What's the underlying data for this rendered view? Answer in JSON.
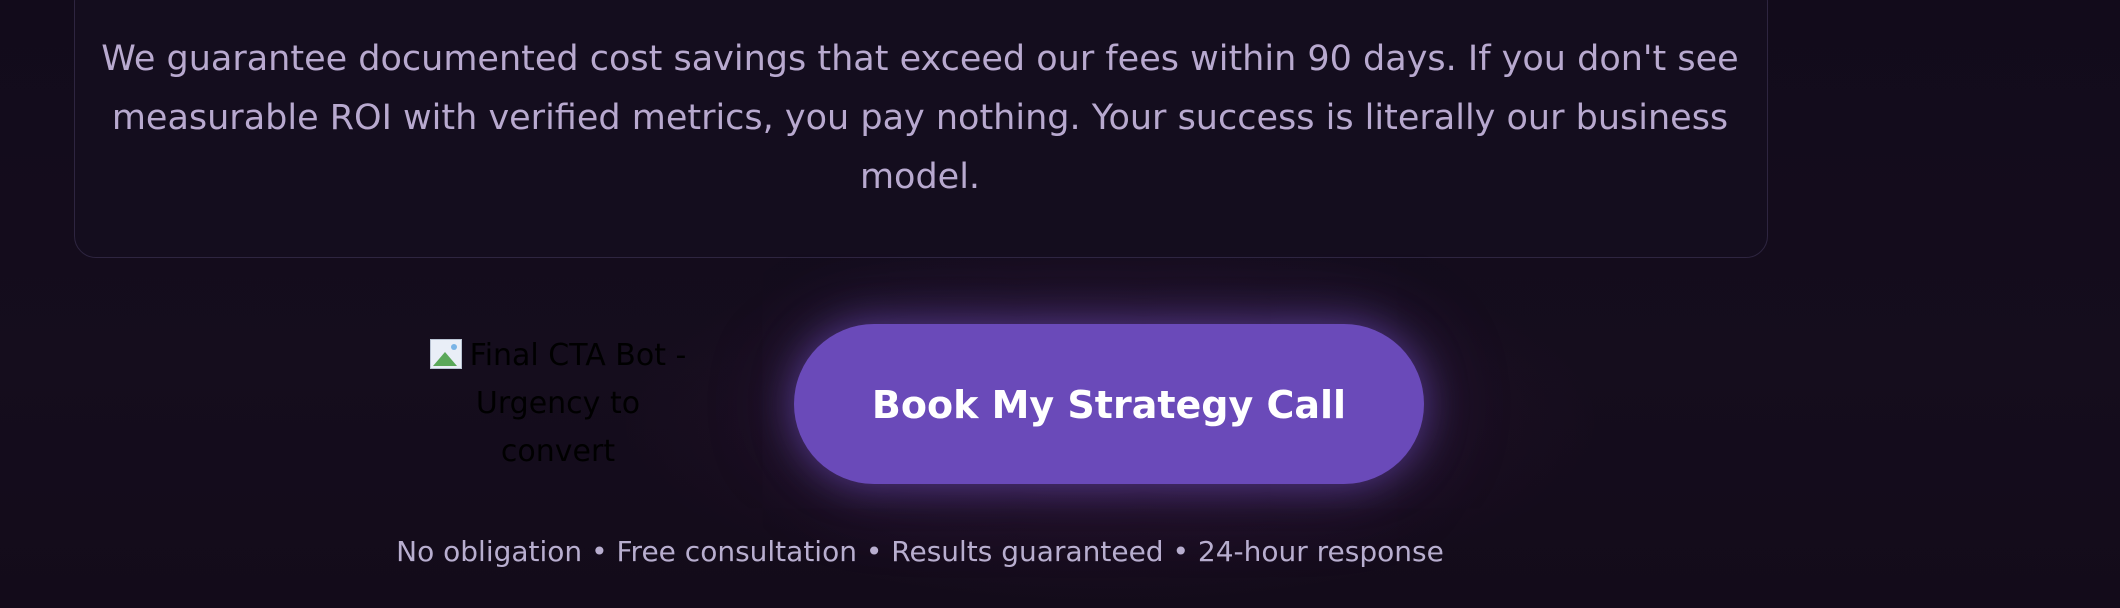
{
  "guarantee": {
    "text": "We guarantee documented cost savings that exceed our fees within 90 days. If you don't see measurable ROI with verified metrics, you pay nothing. Your success is literally our business model."
  },
  "cta": {
    "bot_image_alt": "Final CTA Bot - Urgency to convert",
    "bot_image_icon": "broken-image-icon",
    "button_label": "Book My Strategy Call",
    "button_color": "#6a4ab9",
    "reassurance": "No obligation • Free consultation • Results guaranteed • 24-hour response"
  }
}
